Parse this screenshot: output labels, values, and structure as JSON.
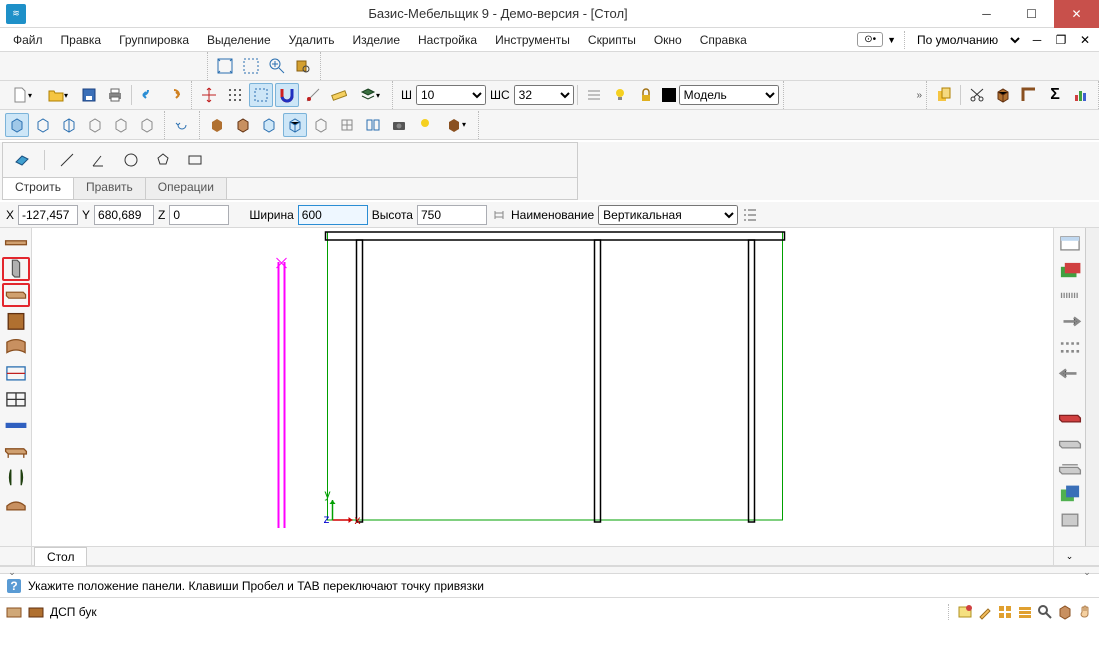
{
  "title": "Базис-Мебельщик 9 - Демо-версия - [Стол]",
  "menus": [
    "Файл",
    "Правка",
    "Группировка",
    "Выделение",
    "Удалить",
    "Изделие",
    "Настройка",
    "Инструменты",
    "Скрипты",
    "Окно",
    "Справка"
  ],
  "layout_select": "По умолчанию",
  "params": {
    "w_label": "Ш",
    "w_value": "10",
    "ws_label": "ШС",
    "ws_value": "32",
    "model_label": "Модель"
  },
  "tabs": {
    "build": "Строить",
    "edit": "Править",
    "ops": "Операции"
  },
  "coords": {
    "x_label": "X",
    "x_value": "-127,457",
    "y_label": "Y",
    "y_value": "680,689",
    "z_label": "Z",
    "z_value": "0",
    "width_label": "Ширина",
    "width_value": "600",
    "height_label": "Высота",
    "height_value": "750",
    "name_label": "Наименование",
    "name_value": "Вертикальная"
  },
  "bottom_tab": "Стол",
  "status_help": "Укажите положение панели. Клавиши Пробел и TAB переключают точку привязки",
  "material": "ДСП бук"
}
